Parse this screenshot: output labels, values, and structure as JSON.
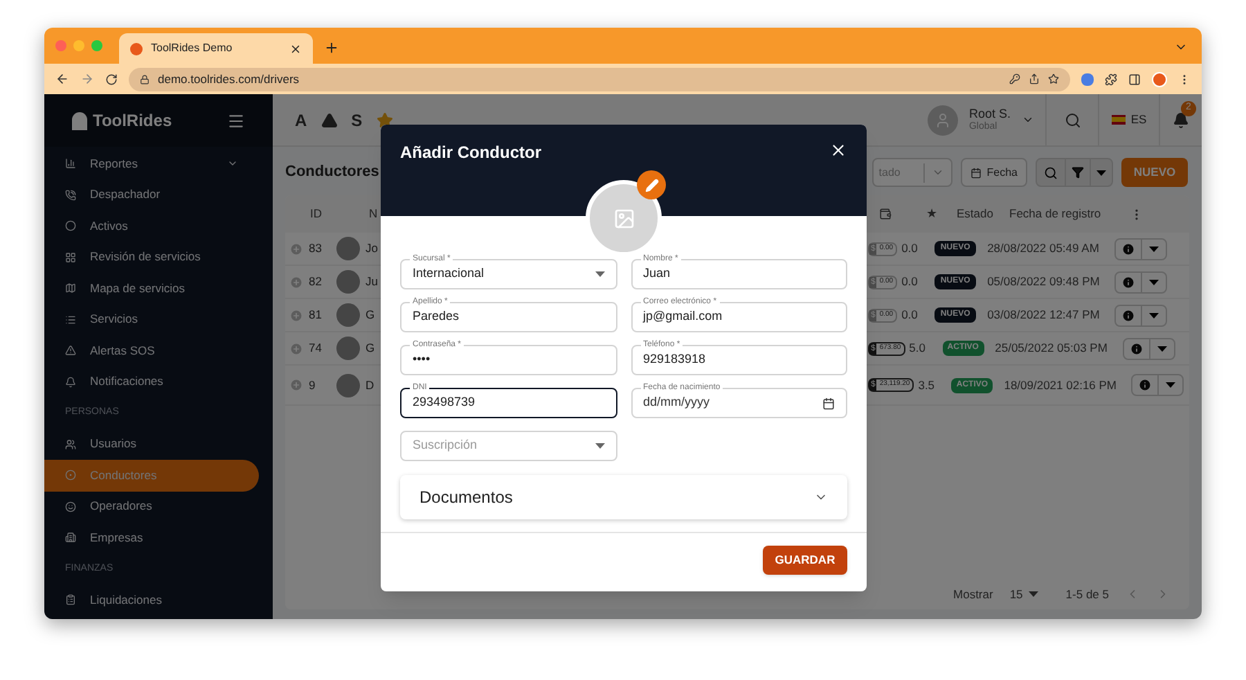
{
  "browser": {
    "tab_title": "ToolRides Demo",
    "url": "demo.toolrides.com/drivers"
  },
  "sidebar": {
    "logo": "ToolRides",
    "items": [
      {
        "kind": "item",
        "label": "Reportes",
        "selected": false,
        "expandable": true
      },
      {
        "kind": "item",
        "label": "Despachador",
        "selected": false,
        "expandable": false
      },
      {
        "kind": "item",
        "label": "Activos",
        "selected": false,
        "expandable": false
      },
      {
        "kind": "item",
        "label": "Revisión de servicios",
        "selected": false,
        "expandable": false
      },
      {
        "kind": "item",
        "label": "Mapa de servicios",
        "selected": false,
        "expandable": false
      },
      {
        "kind": "item",
        "label": "Servicios",
        "selected": false,
        "expandable": false
      },
      {
        "kind": "item",
        "label": "Alertas SOS",
        "selected": false,
        "expandable": false
      },
      {
        "kind": "item",
        "label": "Notificaciones",
        "selected": false,
        "expandable": false
      },
      {
        "kind": "section",
        "label": "PERSONAS"
      },
      {
        "kind": "item",
        "label": "Usuarios",
        "selected": false,
        "expandable": false
      },
      {
        "kind": "item",
        "label": "Conductores",
        "selected": true,
        "expandable": false
      },
      {
        "kind": "item",
        "label": "Operadores",
        "selected": false,
        "expandable": false
      },
      {
        "kind": "item",
        "label": "Empresas",
        "selected": false,
        "expandable": false
      },
      {
        "kind": "section",
        "label": "FINANZAS"
      },
      {
        "kind": "item",
        "label": "Liquidaciones",
        "selected": false,
        "expandable": false
      }
    ]
  },
  "topbar": {
    "shortcuts": [
      {
        "kind": "letter",
        "label": "A"
      },
      {
        "kind": "alert"
      },
      {
        "kind": "letter",
        "label": "S"
      },
      {
        "kind": "star"
      }
    ],
    "user": {
      "name": "Root S.",
      "role": "Global"
    },
    "language": "ES",
    "notifications": "2"
  },
  "page": {
    "title": "Conductores",
    "status_filter": "tado",
    "date_button": "Fecha",
    "new_button": "NUEVO"
  },
  "table": {
    "columns_left": [
      "ID",
      "N"
    ],
    "columns_right": [
      "★",
      "Estado",
      "Fecha de registro"
    ],
    "rows": [
      {
        "id": "83",
        "name": "Jo",
        "currency": "$",
        "balance": "0.00",
        "rating": "0.0",
        "status": {
          "kind": "new",
          "label": "NUEVO"
        },
        "date": "28/08/2022 05:49 AM"
      },
      {
        "id": "82",
        "name": "Ju",
        "currency": "$",
        "balance": "0.00",
        "rating": "0.0",
        "status": {
          "kind": "new",
          "label": "NUEVO"
        },
        "date": "05/08/2022 09:48 PM"
      },
      {
        "id": "81",
        "name": "G",
        "currency": "$",
        "balance": "0.00",
        "rating": "0.0",
        "status": {
          "kind": "new",
          "label": "NUEVO"
        },
        "date": "03/08/2022 12:47 PM"
      },
      {
        "id": "74",
        "name": "G",
        "currency": "$",
        "balance": "673.80",
        "rating": "5.0",
        "status": {
          "kind": "active",
          "label": "ACTIVO"
        },
        "date": "25/05/2022 05:03 PM"
      },
      {
        "id": "9",
        "name": "D",
        "currency": "$",
        "balance": "23,119.20",
        "rating": "3.5",
        "status": {
          "kind": "active",
          "label": "ACTIVO"
        },
        "date": "18/09/2021 02:16 PM"
      }
    ]
  },
  "pagination": {
    "label": "Mostrar",
    "per_page": "15",
    "range": "1-5 de 5"
  },
  "modal": {
    "title": "Añadir Conductor",
    "fields": [
      {
        "kind": "select",
        "label": "Sucursal *",
        "value": "Internacional",
        "focused": false
      },
      {
        "kind": "text",
        "label": "Nombre *",
        "value": "Juan",
        "focused": false
      },
      {
        "kind": "text",
        "label": "Apellido *",
        "value": "Paredes",
        "focused": false
      },
      {
        "kind": "text",
        "label": "Correo electrónico *",
        "value": "jp@gmail.com",
        "focused": false
      },
      {
        "kind": "text",
        "label": "Contraseña *",
        "value": "••••",
        "focused": false
      },
      {
        "kind": "text",
        "label": "Teléfono *",
        "value": "929183918",
        "focused": false
      },
      {
        "kind": "text",
        "label": "DNI",
        "value": "293498739",
        "focused": true
      },
      {
        "kind": "date",
        "label": "Fecha de nacimiento",
        "placeholder": "dd/mm/yyyy",
        "focused": false
      },
      {
        "kind": "select",
        "placeholder": "Suscripción",
        "focused": false
      }
    ],
    "documents": {
      "label": "Documentos",
      "expanded": false
    },
    "save_button": "GUARDAR"
  }
}
